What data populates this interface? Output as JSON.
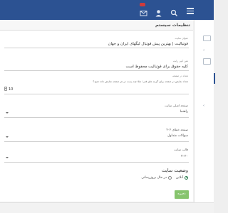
{
  "topbar": {
    "admin_label": "",
    "icons": [
      "menu-icon",
      "search-icon",
      "user-icon",
      "mail-icon"
    ],
    "color": "#2c5292"
  },
  "panel": {
    "title": "تنظیمات سیستم"
  },
  "fields": {
    "site_title": {
      "label": "عنوان سایت",
      "value": "فوتبالیت | بهترین پیش فوتبال لیگهای ایران و جهان"
    },
    "copyright": {
      "label": "متن کپی رایت",
      "value": "کلیه حقوق برای فوتبالیت محفوظ است"
    },
    "per_page": {
      "label": "تعداد در صفحه",
      "question": "تعداد نمایش در صفحه برای گزینه های فنی؛ مثلا چند پست در هر صفحه نمایش داده شود؟",
      "value": "10"
    },
    "home_page": {
      "section": "صفحه اصلی سایت",
      "value": "راهنما"
    },
    "not_found": {
      "section": "صفحه خطای ۴۰۴",
      "value": "سوالات متداول"
    },
    "layout": {
      "section": "قالب سایت",
      "value": "۲۰۲۰"
    }
  },
  "site_status": {
    "title": "وضعیت سایت",
    "options": [
      {
        "label": "آنلاین",
        "selected": true
      },
      {
        "label": "در حال بروزرسانی",
        "selected": false
      }
    ]
  },
  "save_label": "ذخیره",
  "colors": {
    "accent": "#2c5292",
    "save": "#86c46d"
  }
}
